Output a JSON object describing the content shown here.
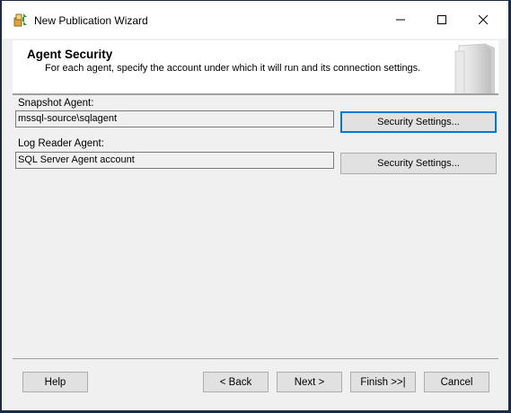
{
  "window": {
    "title": "New Publication Wizard",
    "app_icon": "wizard-icon"
  },
  "controls": {
    "minimize_icon": "minimize-icon",
    "maximize_icon": "maximize-icon",
    "close_icon": "close-icon"
  },
  "header": {
    "title": "Agent Security",
    "subtitle": "For each agent, specify the account under which it will run and its connection settings."
  },
  "agents": [
    {
      "label": "Snapshot Agent:",
      "value": "mssql-source\\sqlagent",
      "button": "Security Settings..."
    },
    {
      "label": "Log Reader Agent:",
      "value": "SQL Server Agent account",
      "button": "Security Settings..."
    }
  ],
  "footer": {
    "help": "Help",
    "back": "< Back",
    "next": "Next >",
    "finish": "Finish >>|",
    "cancel": "Cancel"
  },
  "colors": {
    "focus_border": "#0078d7",
    "dialog_bg": "#f0f0f0",
    "desktop_bg": "#1b2b45"
  }
}
